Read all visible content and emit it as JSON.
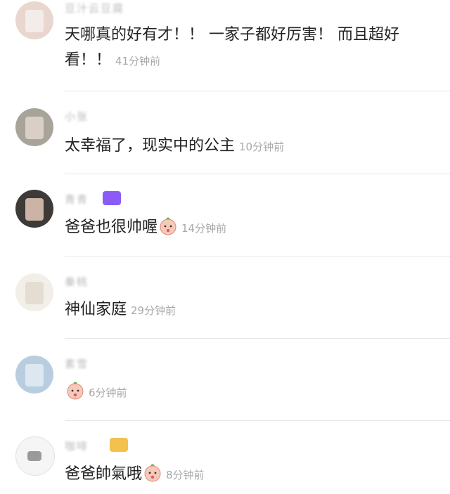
{
  "comments": [
    {
      "username": "豆汁云豆腐",
      "text": "天哪真的好有才！！ 一家子都好厉害！ 而且超好看！！",
      "time": "41分钟前"
    },
    {
      "username": "小张",
      "text": "太幸福了，现实中的公主",
      "time": "10分钟前"
    },
    {
      "username": "青青",
      "text": "爸爸也很帅喔",
      "emoji": "shy-face-emoji",
      "time": "14分钟前"
    },
    {
      "username": "秦桃",
      "text": "神仙家庭",
      "time": "29分钟前"
    },
    {
      "username": "素雪",
      "text": "",
      "emoji": "shy-face-emoji",
      "time": "6分钟前"
    },
    {
      "username": "咖啡",
      "text": "爸爸帥氣哦",
      "emoji": "shy-face-emoji",
      "time": "8分钟前"
    }
  ],
  "colors": {
    "badge_purple": "#8a5cf5",
    "badge_gold": "#f2c14e",
    "emoji_face": "#f6c9b8"
  }
}
